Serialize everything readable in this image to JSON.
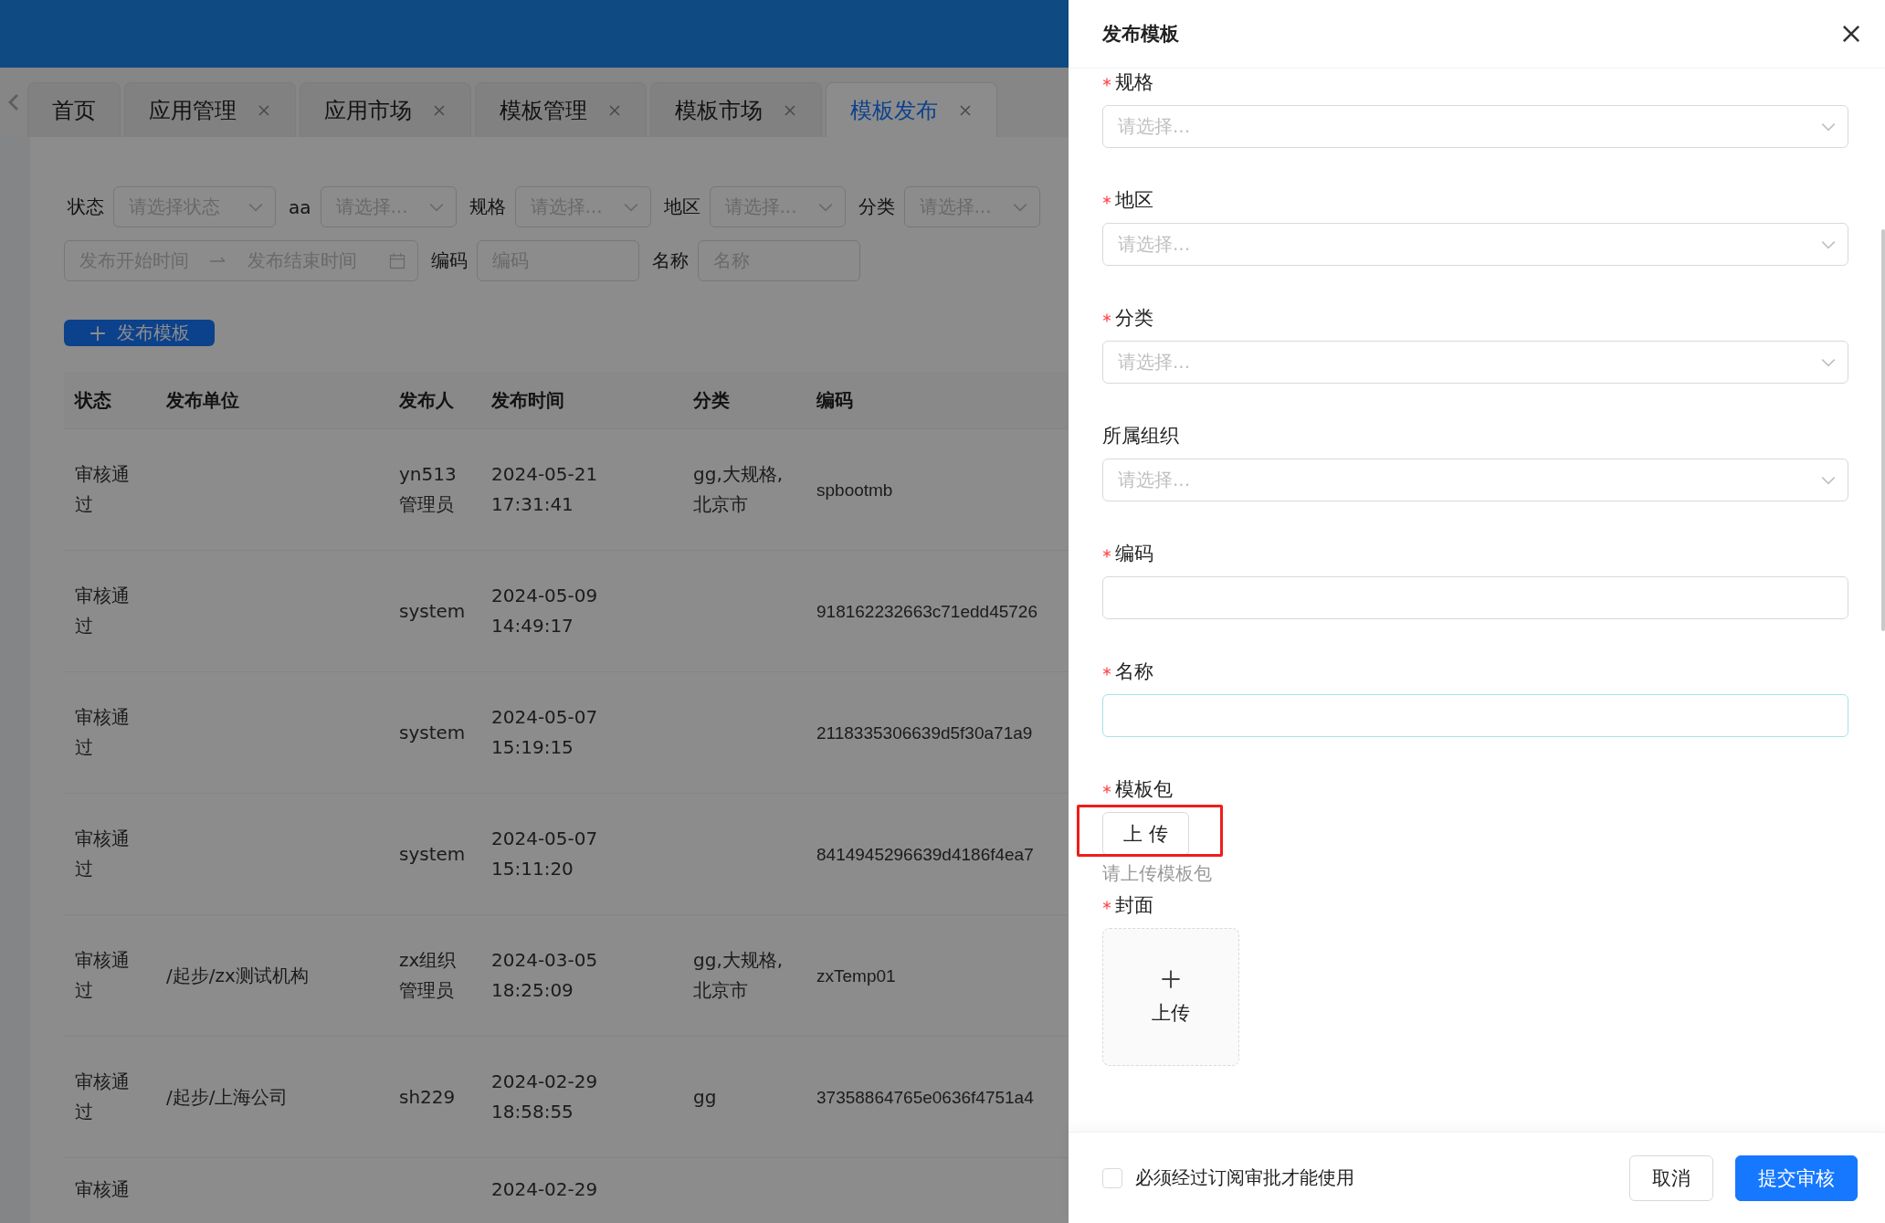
{
  "tabs": [
    {
      "label": "首页",
      "closable": false,
      "selected": false
    },
    {
      "label": "应用管理",
      "closable": true,
      "selected": false
    },
    {
      "label": "应用市场",
      "closable": true,
      "selected": false
    },
    {
      "label": "模板管理",
      "closable": true,
      "selected": false
    },
    {
      "label": "模板市场",
      "closable": true,
      "selected": false
    },
    {
      "label": "模板发布",
      "closable": true,
      "selected": true
    }
  ],
  "filters": [
    {
      "label": "状态",
      "placeholder": "请选择状态"
    },
    {
      "label": "aa",
      "placeholder": "请选择..."
    },
    {
      "label": "规格",
      "placeholder": "请选择..."
    },
    {
      "label": "地区",
      "placeholder": "请选择..."
    },
    {
      "label": "分类",
      "placeholder": "请选择..."
    }
  ],
  "date_range": {
    "start_placeholder": "发布开始时间",
    "end_placeholder": "发布结束时间"
  },
  "search_fields": [
    {
      "label": "编码",
      "placeholder": "编码"
    },
    {
      "label": "名称",
      "placeholder": "名称"
    }
  ],
  "publish_button": "发布模板",
  "table": {
    "columns": [
      "状态",
      "发布单位",
      "发布人",
      "发布时间",
      "分类",
      "编码"
    ],
    "rows": [
      {
        "status": "审核通过",
        "publisher": "yn513管理员",
        "time": "2024-05-21 17:31:41",
        "category": "gg,大规格,北京市",
        "code": "spbootmb"
      },
      {
        "status": "审核通过",
        "publisher": "system",
        "time": "2024-05-09 14:49:17",
        "code": "918162232663c71edd45726"
      },
      {
        "status": "审核通过",
        "publisher": "system",
        "time": "2024-05-07 15:19:15",
        "code": "2118335306639d5f30a71a9"
      },
      {
        "status": "审核通过",
        "publisher": "system",
        "time": "2024-05-07 15:11:20",
        "code": "8414945296639d4186f4ea7"
      },
      {
        "status": "审核通过",
        "unit": "/起步/zx测试机构",
        "publisher": "zx组织管理员",
        "time": "2024-03-05 18:25:09",
        "category": "gg,大规格,北京市",
        "code": "zxTemp01"
      },
      {
        "status": "审核通过",
        "unit": "/起步/上海公司",
        "publisher": "sh229",
        "time": "2024-02-29 18:58:55",
        "category": "gg",
        "code": "37358864765e0636f4751a4"
      },
      {
        "status": "审核通",
        "time": "2024-02-29"
      }
    ]
  },
  "drawer": {
    "title": "发布模板",
    "fields": [
      {
        "kind": "select",
        "label": "规格",
        "required": true,
        "placeholder": "请选择..."
      },
      {
        "kind": "select",
        "label": "地区",
        "required": true,
        "placeholder": "请选择..."
      },
      {
        "kind": "select",
        "label": "分类",
        "required": true,
        "placeholder": "请选择..."
      },
      {
        "kind": "select",
        "label": "所属组织",
        "required": false,
        "placeholder": "请选择..."
      },
      {
        "kind": "input",
        "label": "编码",
        "required": true,
        "focused": false
      },
      {
        "kind": "input",
        "label": "名称",
        "required": true,
        "focused": true
      },
      {
        "kind": "upload-button",
        "label": "模板包",
        "required": true,
        "button": "上 传",
        "hint": "请上传模板包",
        "highlighted": true
      },
      {
        "kind": "upload-card",
        "label": "封面",
        "required": true,
        "button": "上传"
      }
    ],
    "checkbox": {
      "label": "必须经过订阅审批才能使用",
      "checked": false
    },
    "buttons": [
      {
        "label": "取消",
        "kind": "default"
      },
      {
        "label": "提交审核",
        "kind": "primary"
      }
    ]
  }
}
